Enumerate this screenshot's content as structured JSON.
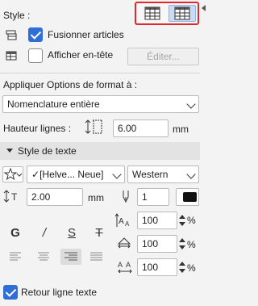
{
  "style": {
    "label": "Style :",
    "merge_label": "Fusionner articles",
    "merge_checked": true,
    "header_label": "Afficher en-tête",
    "header_checked": false,
    "edit_button": "Éditer..."
  },
  "apply": {
    "label": "Appliquer Options de format à :",
    "value": "Nomenclature entière"
  },
  "row_height": {
    "label": "Hauteur lignes :",
    "value": "6.00",
    "unit": "mm"
  },
  "text_style": {
    "header": "Style de texte",
    "font": "[Helve... Neue]",
    "script": "Western",
    "size_value": "2.00",
    "size_unit": "mm",
    "pen_value": "1",
    "bold": "G",
    "italic": "/",
    "underline": "S",
    "strike": "T",
    "width_factor": "100",
    "spacing_factor": "100",
    "char_spacing": "100",
    "percent": "%"
  },
  "wrap": {
    "label": "Retour ligne texte",
    "checked": true
  },
  "colors": {
    "accent": "#2f6ed6",
    "highlight_border": "#e0282d",
    "selected_button": "#c9dcf3"
  }
}
